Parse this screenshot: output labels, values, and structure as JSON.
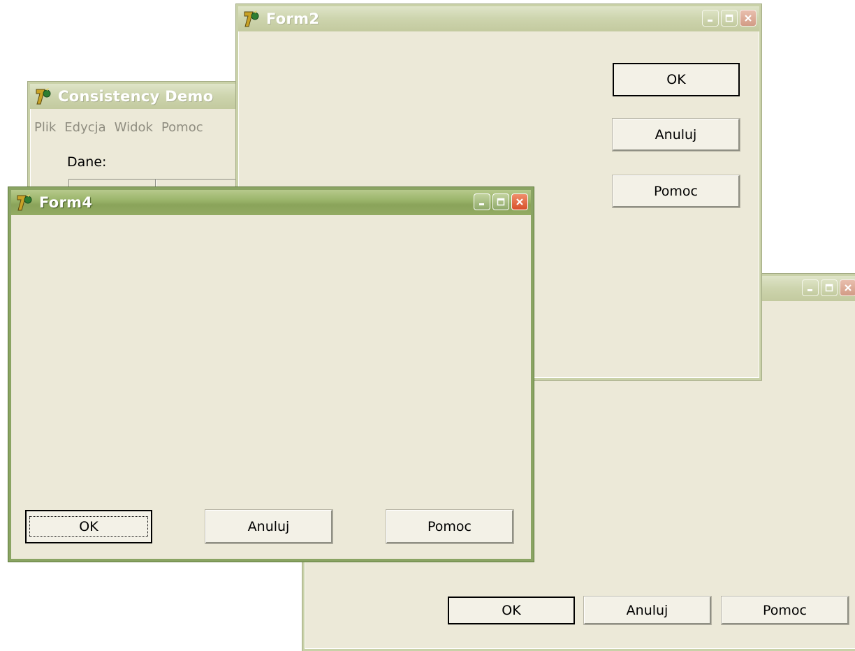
{
  "form2": {
    "title": "Form2",
    "buttons": {
      "ok": "OK",
      "cancel": "Anuluj",
      "help": "Pomoc"
    }
  },
  "consistency": {
    "title": "Consistency Demo",
    "menu": [
      "Plik",
      "Edycja",
      "Widok",
      "Pomoc"
    ],
    "label": "Dane:"
  },
  "form_back": {
    "title": "",
    "buttons": {
      "ok": "OK",
      "cancel": "Anuluj",
      "help": "Pomoc"
    }
  },
  "form4": {
    "title": "Form4",
    "buttons": {
      "ok": "OK",
      "cancel": "Anuluj",
      "help": "Pomoc"
    }
  },
  "icons": {
    "app": "delphi-app-icon",
    "minimize": "minimize-icon",
    "maximize": "maximize-icon",
    "close": "close-icon"
  },
  "colors": {
    "face": "#ece9d8",
    "active_title": "#8aa35a",
    "inactive_title": "#cdd4ad",
    "close_red": "#d8502a"
  }
}
